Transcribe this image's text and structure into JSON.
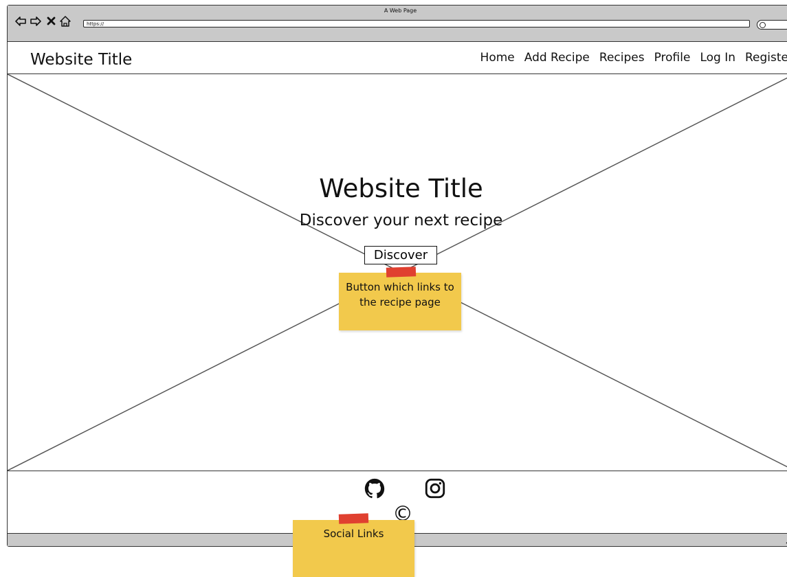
{
  "browser": {
    "window_title": "A Web Page",
    "address": "https://",
    "buttons": [
      "back-arrow",
      "forward-arrow",
      "close-x",
      "home"
    ]
  },
  "nav": {
    "site_title": "Website Title",
    "links": [
      "Home",
      "Add Recipe",
      "Recipes",
      "Profile",
      "Log In",
      "Register"
    ]
  },
  "hero": {
    "title": "Website Title",
    "subtitle": "Discover your next recipe",
    "button_label": "Discover"
  },
  "notes": {
    "button_note": "Button which links to the recipe page",
    "social_note": "Social Links"
  },
  "footer": {
    "icons": [
      "github-icon",
      "instagram-icon"
    ],
    "copyright_symbol": "©"
  },
  "colors": {
    "chrome": "#c9c9c9",
    "sticky": "#f2c94c",
    "tape": "#e04030"
  }
}
